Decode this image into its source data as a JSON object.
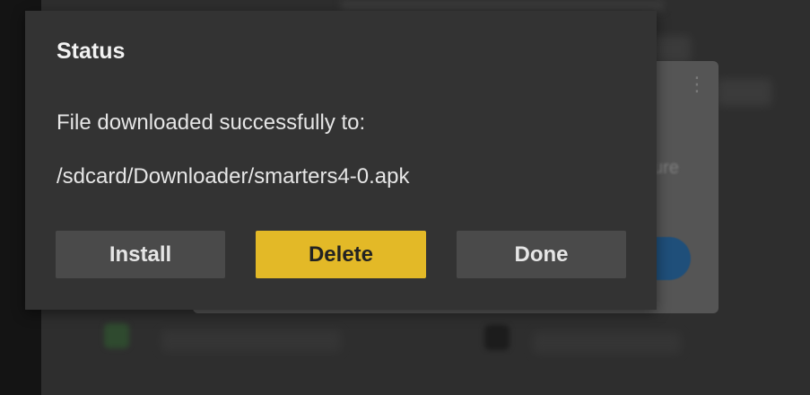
{
  "dialog": {
    "title": "Status",
    "message_line1": "File downloaded successfully to:",
    "message_line2": "/sdcard/Downloader/smarters4-0.apk",
    "buttons": {
      "install": "Install",
      "delete": "Delete",
      "done": "Done"
    },
    "focused_button": "delete"
  },
  "background": {
    "card_text_1": "ure",
    "card_kebab": "⋮"
  },
  "colors": {
    "dialog_bg": "#333333",
    "button_bg": "#4a4a4a",
    "focused_button_bg": "#e3b927",
    "text": "#e6e6e6",
    "accent_blue": "#1f4f7a"
  }
}
